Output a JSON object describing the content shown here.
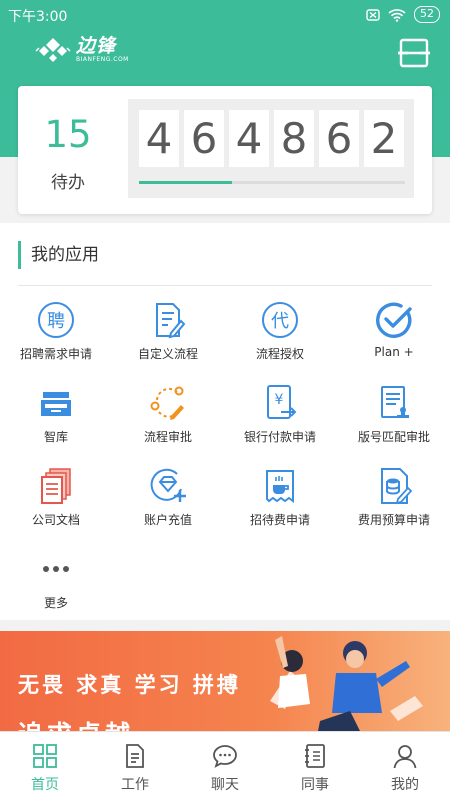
{
  "status_bar": {
    "time": "下午3:00",
    "battery": "52"
  },
  "header": {
    "logo_cn": "边锋",
    "logo_en": "BIANFENG.COM",
    "scan_icon": "scan-icon"
  },
  "todo": {
    "count": "15",
    "label": "待办",
    "counter_digits": [
      "4",
      "6",
      "4",
      "8",
      "6",
      "2"
    ],
    "progress": 0.35
  },
  "apps": {
    "title": "我的应用",
    "items": [
      {
        "label": "招聘需求申请",
        "icon": "recruit-icon"
      },
      {
        "label": "自定义流程",
        "icon": "edit-document-icon"
      },
      {
        "label": "流程授权",
        "icon": "authorize-icon"
      },
      {
        "label": "Plan +",
        "icon": "check-circle-icon"
      },
      {
        "label": "智库",
        "icon": "archive-tray-icon"
      },
      {
        "label": "流程审批",
        "icon": "flow-approve-icon"
      },
      {
        "label": "银行付款申请",
        "icon": "bank-payment-icon"
      },
      {
        "label": "版号匹配审批",
        "icon": "stamp-document-icon"
      },
      {
        "label": "公司文档",
        "icon": "company-docs-icon"
      },
      {
        "label": "账户充值",
        "icon": "diamond-recharge-icon"
      },
      {
        "label": "招待费申请",
        "icon": "coffee-receipt-icon"
      },
      {
        "label": "费用预算申请",
        "icon": "budget-icon"
      },
      {
        "label": "更多",
        "icon": "more-dots-icon"
      }
    ]
  },
  "banner": {
    "slogan_line1": "无畏 求真 学习 拼搏",
    "slogan_line2": "追求卓越"
  },
  "tabs": [
    {
      "label": "首页",
      "icon": "home-grid-icon",
      "active": true
    },
    {
      "label": "工作",
      "icon": "document-icon",
      "active": false
    },
    {
      "label": "聊天",
      "icon": "chat-icon",
      "active": false
    },
    {
      "label": "同事",
      "icon": "contacts-icon",
      "active": false
    },
    {
      "label": "我的",
      "icon": "user-icon",
      "active": false
    }
  ],
  "colors": {
    "brand": "#3dbc9a",
    "icon_blue": "#3b8de0",
    "icon_orange": "#f0921e",
    "icon_red": "#e4584c",
    "banner": "#f26a43"
  }
}
